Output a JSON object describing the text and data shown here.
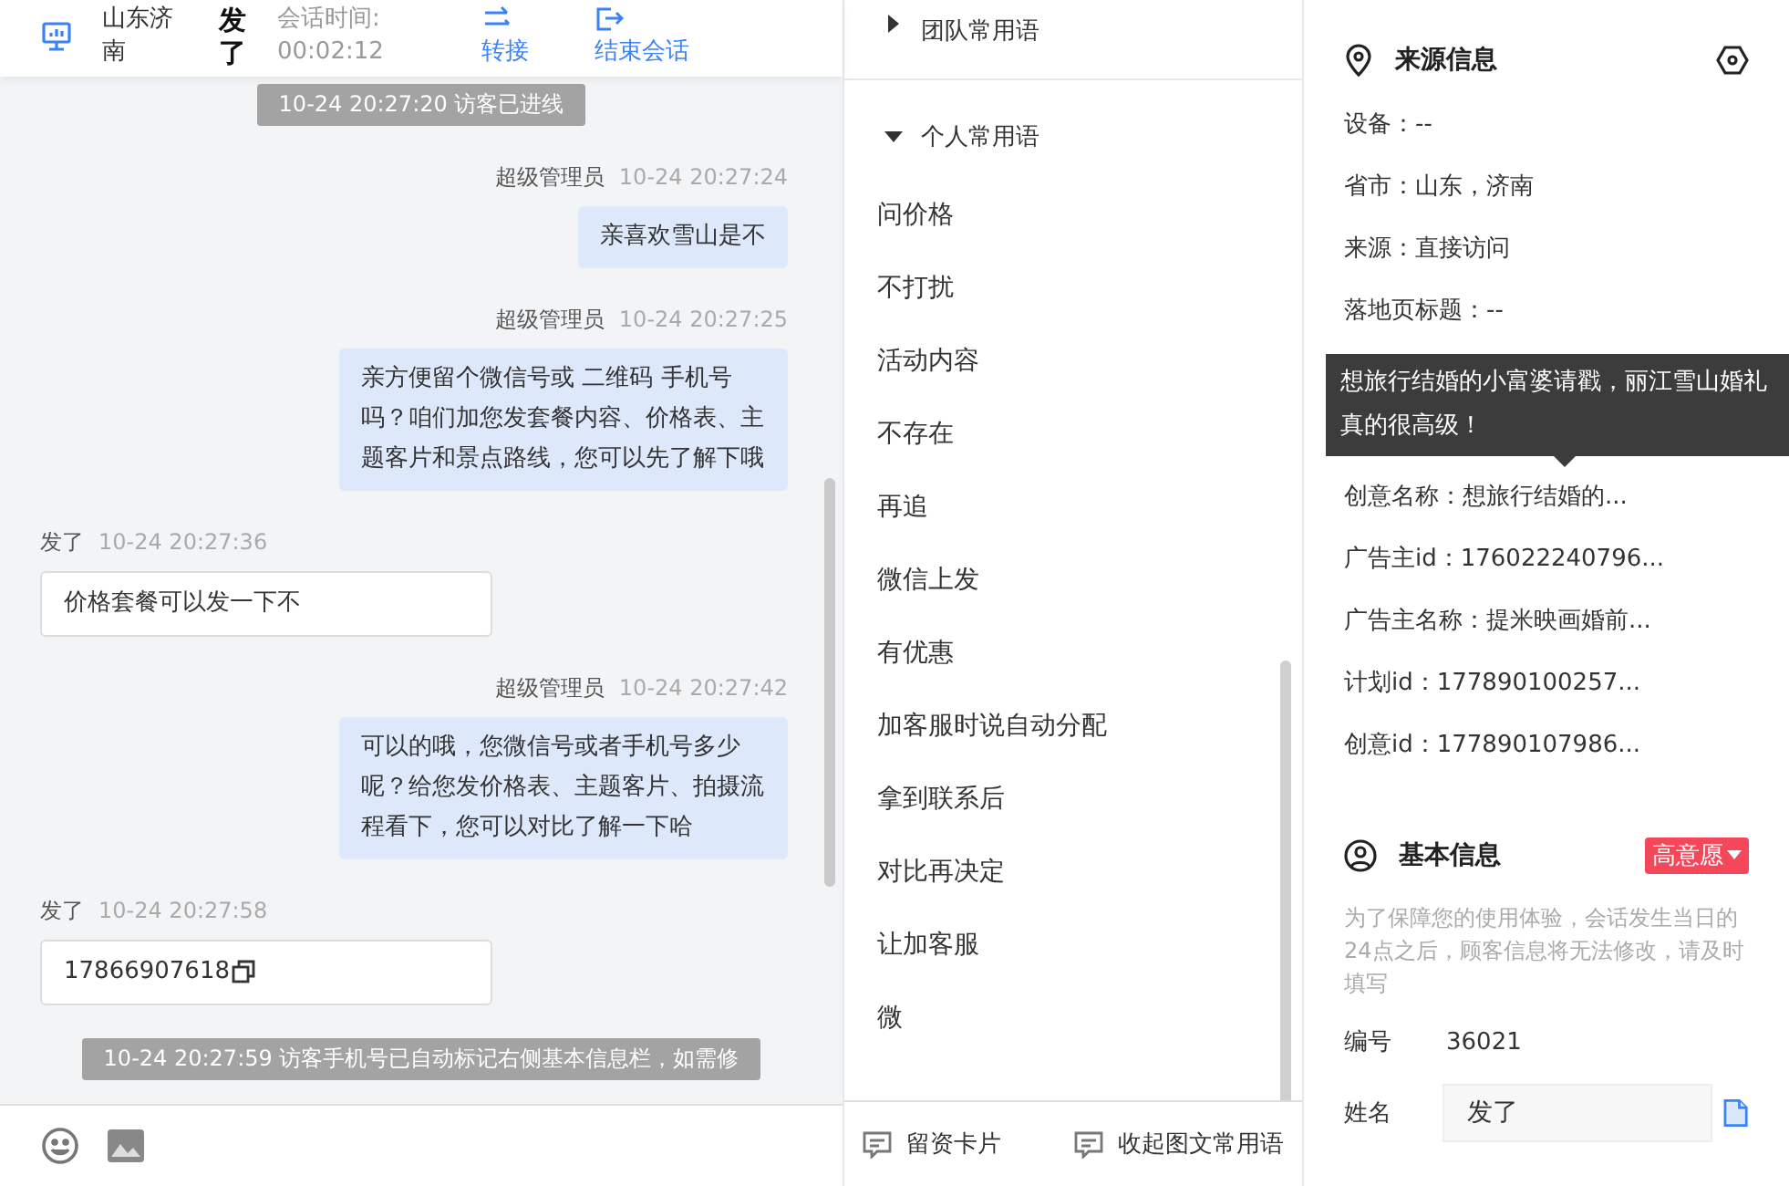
{
  "chat": {
    "header": {
      "location": "山东济南",
      "visitor": "发了",
      "duration_label": "会话时间:",
      "duration": "00:02:12",
      "actions": [
        {
          "label": "转接",
          "kind": "transfer"
        },
        {
          "label": "结束会话",
          "kind": "end"
        }
      ]
    },
    "messages": [
      {
        "kind": "system",
        "text": "10-24 20:27:20 访客已进线"
      },
      {
        "kind": "agent",
        "sender": "超级管理员",
        "time": "10-24 20:27:24",
        "text": "亲喜欢雪山是不"
      },
      {
        "kind": "agent",
        "sender": "超级管理员",
        "time": "10-24 20:27:25",
        "text": "亲方便留个微信号或 二维码 手机号吗？咱们加您发套餐内容、价格表、主题客片和景点路线，您可以先了解下哦"
      },
      {
        "kind": "visitor",
        "sender": "发了",
        "time": "10-24 20:27:36",
        "text": "价格套餐可以发一下不"
      },
      {
        "kind": "agent",
        "sender": "超级管理员",
        "time": "10-24 20:27:42",
        "text": "可以的哦，您微信号或者手机号多少呢？给您发价格表、主题客片、拍摄流程看下，您可以对比了解一下哈"
      },
      {
        "kind": "visitor_phone",
        "sender": "发了",
        "time": "10-24 20:27:58",
        "text": "17866907618"
      },
      {
        "kind": "system",
        "text": "10-24 20:27:59 访客手机号已自动标记右侧基本信息栏，如需修"
      }
    ]
  },
  "phrases": {
    "groups": [
      {
        "label": "团队常用语",
        "expanded": false
      },
      {
        "label": "个人常用语",
        "expanded": true
      }
    ],
    "items": [
      "问价格",
      "不打扰",
      "活动内容",
      "不存在",
      "再追",
      "微信上发",
      "有优惠",
      "加客服时说自动分配",
      "拿到联系后",
      "对比再决定",
      "让加客服",
      "微"
    ],
    "footer": [
      "留资卡片",
      "收起图文常用语"
    ]
  },
  "source_info": {
    "title": "来源信息",
    "rows_before": [
      "设备：--",
      "省市：山东，济南",
      "来源：直接访问",
      "落地页标题：--"
    ],
    "tooltip": "想旅行结婚的小富婆请戳，丽江雪山婚礼真的很高级！",
    "rows_after": [
      "创意名称：想旅行结婚的...",
      "广告主id：176022240796...",
      "广告主名称：提米映画婚前...",
      "计划id：177890100257...",
      "创意id：177890107986..."
    ]
  },
  "basic_info": {
    "title": "基本信息",
    "intent": "高意愿",
    "notice": "为了保障您的使用体验，会话发生当日的24点之后，顾客信息将无法修改，请及时填写",
    "fields": [
      {
        "label": "编号",
        "value": "36021",
        "kind": "text"
      },
      {
        "label": "姓名",
        "value": "发了",
        "kind": "input"
      }
    ]
  }
}
